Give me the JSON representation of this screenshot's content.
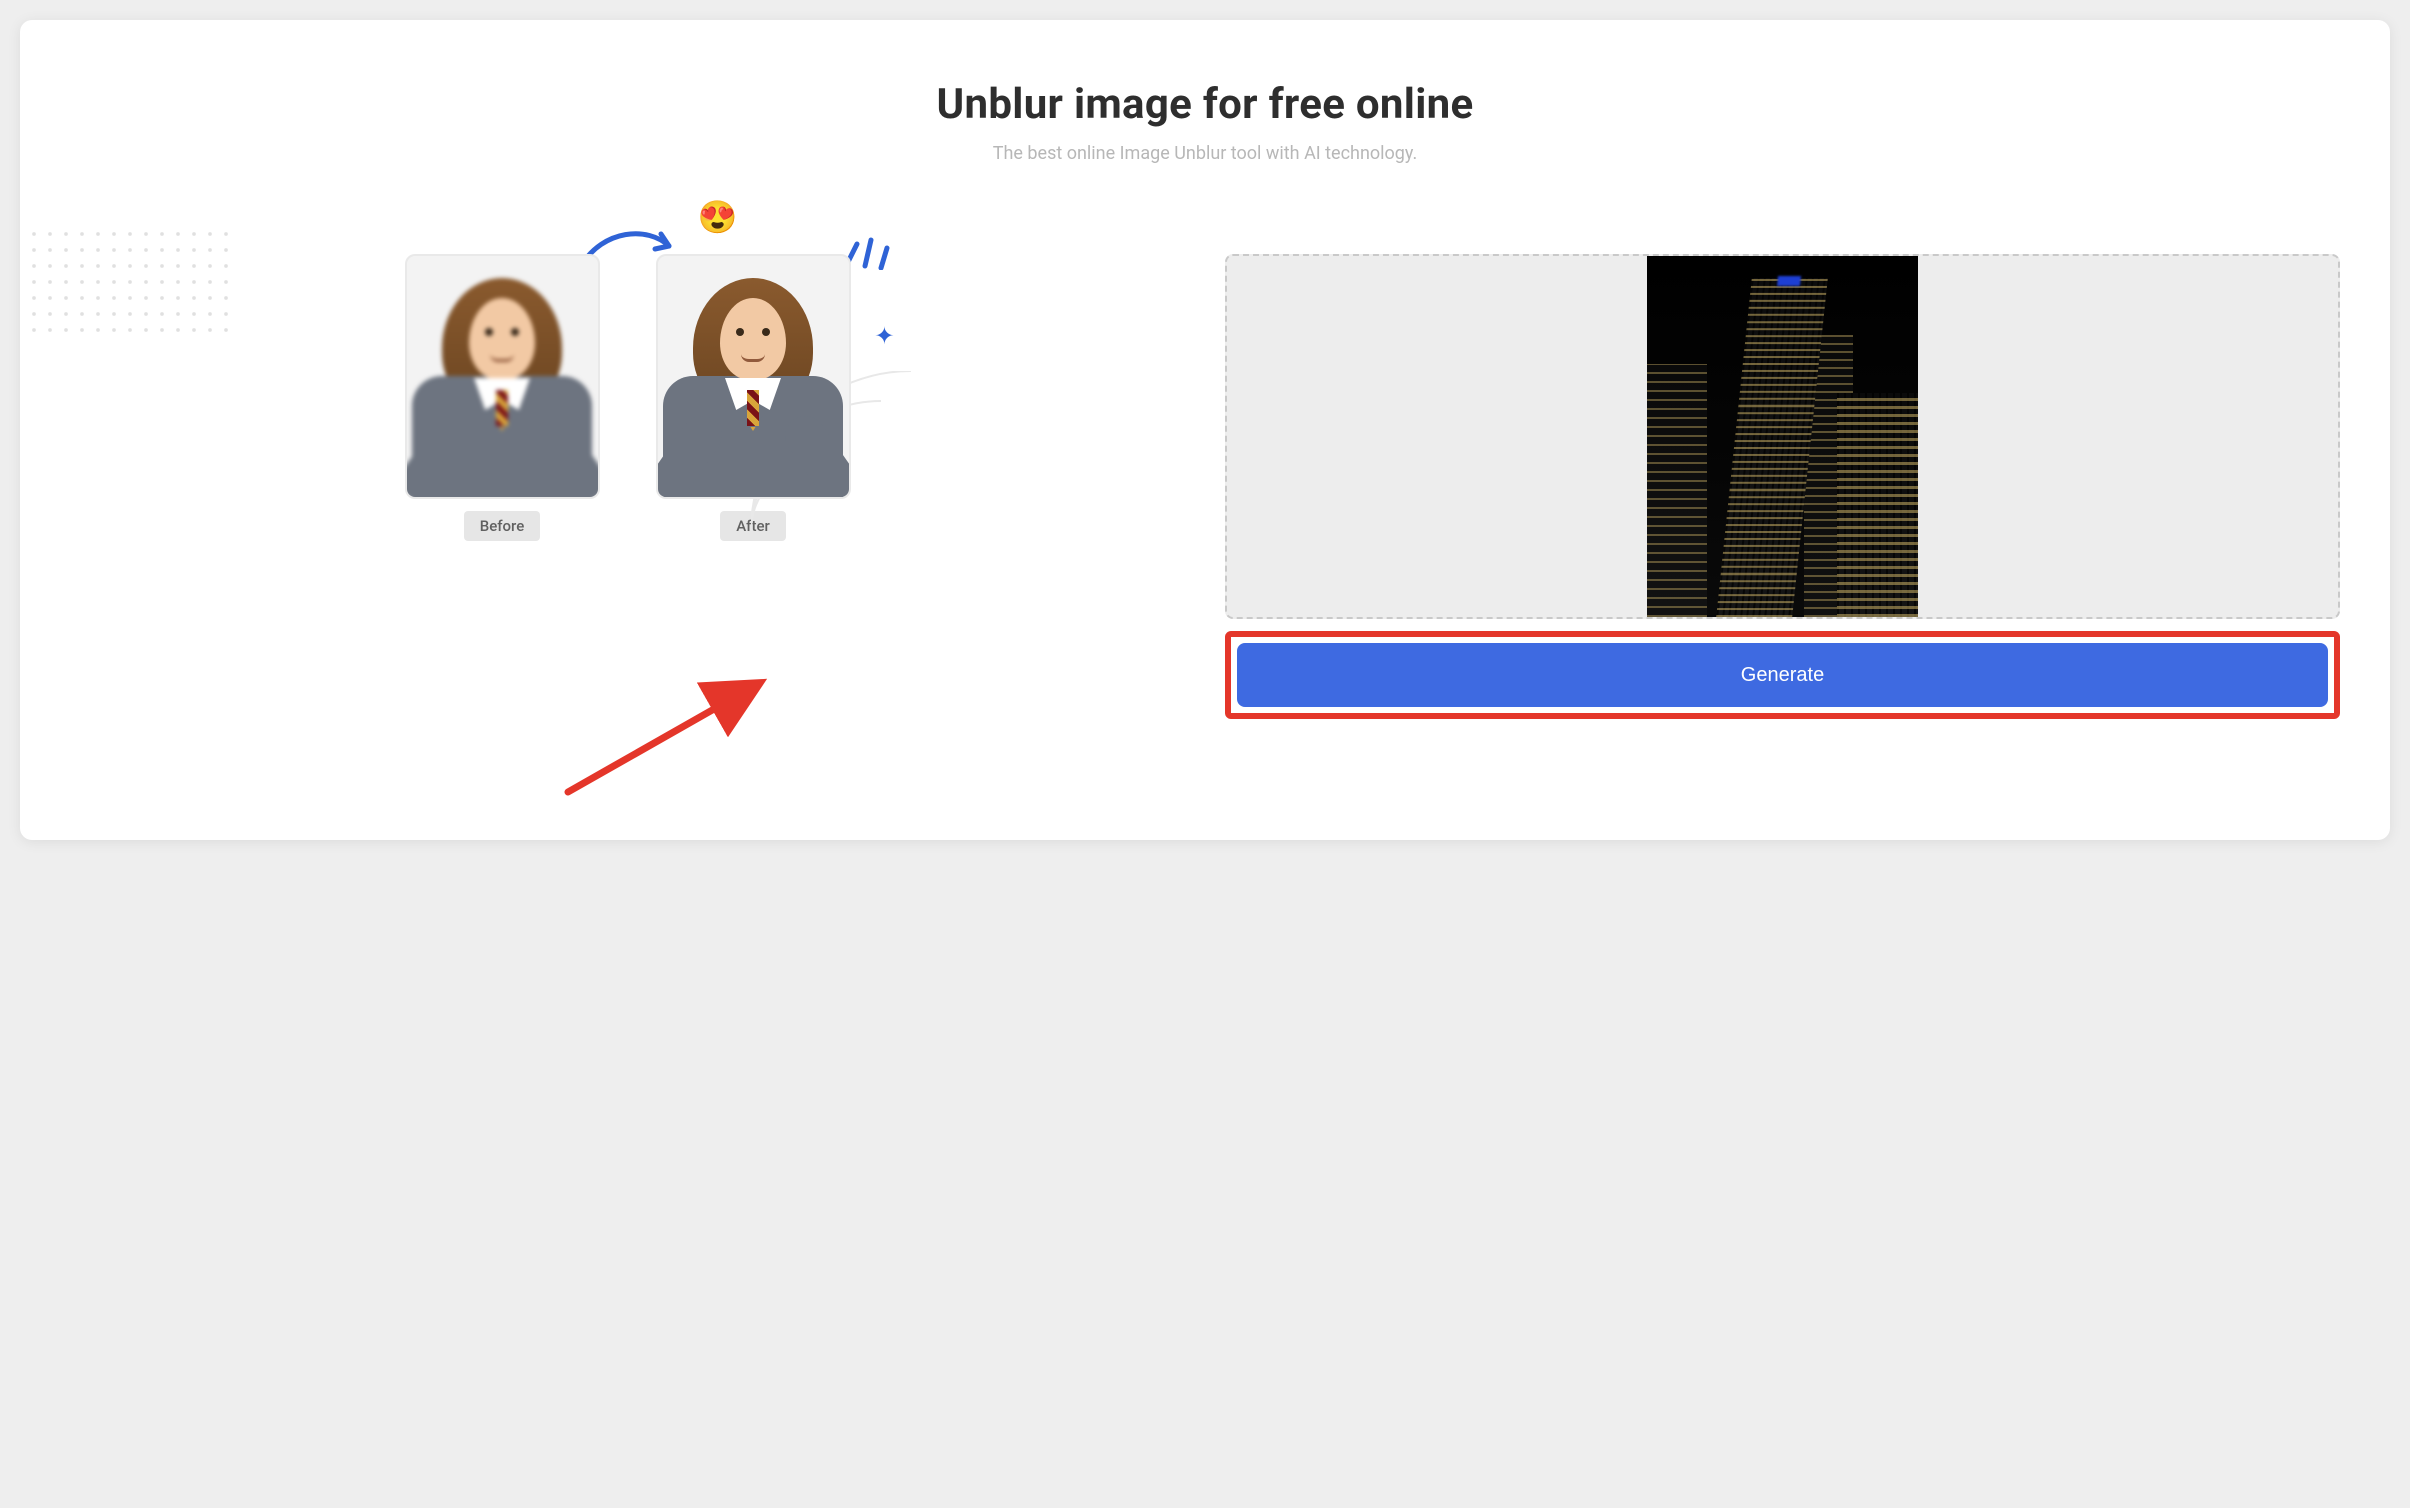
{
  "header": {
    "title": "Unblur image for free online",
    "subtitle": "The best online Image Unblur tool with AI technology."
  },
  "demo": {
    "before_label": "Before",
    "after_label": "After",
    "emoji_icon": "heart-eyes-emoji"
  },
  "upload": {
    "preview_description": "night-city-skyscraper-photo"
  },
  "actions": {
    "generate_label": "Generate"
  },
  "annotations": {
    "highlight_target": "generate-button",
    "arrow_target": "generate-button"
  },
  "colors": {
    "primary_button": "#3e6ae1",
    "annotation_red": "#e4362a",
    "accent_blue": "#2f63d6"
  }
}
